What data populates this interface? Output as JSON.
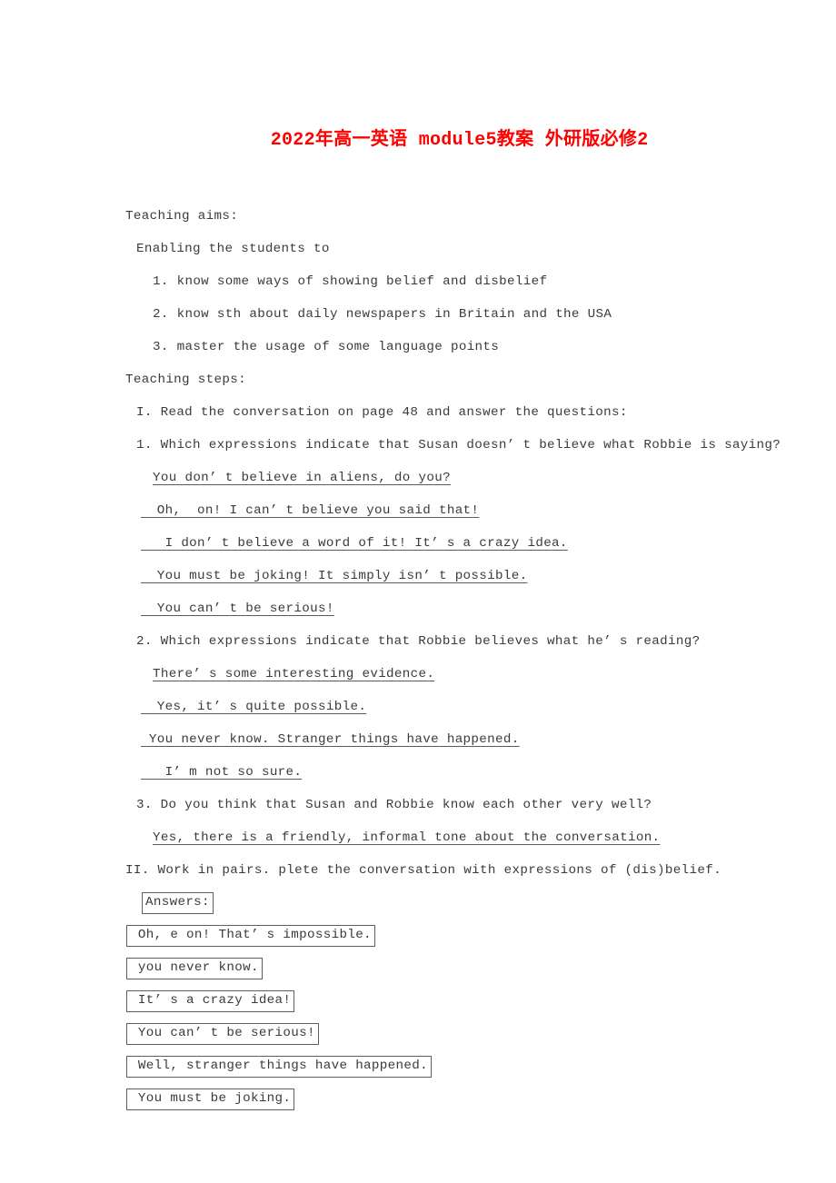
{
  "document": {
    "title": "2022年高一英语 module5教案 外研版必修2",
    "title_color": "#fe0000",
    "text_color": "#3b3b3b",
    "sections": {
      "teaching_aims_heading": "Teaching aims:",
      "enabling_line": "Enabling the students to",
      "aims": [
        "1. know some ways of showing belief and disbelief",
        "2. know sth about daily newspapers in Britain and the USA",
        "3. master the usage of some language points"
      ],
      "teaching_steps_heading": "Teaching steps:",
      "step_one_heading": "I. Read the conversation on page 48 and answer the questions:",
      "q1": "1. Which expressions indicate that Susan doesn’ t believe what Robbie is saying?",
      "q1_answers": [
        "You don’ t believe in aliens, do you?",
        "  Oh,  on! I can’ t believe you said that!",
        "   I don’ t believe a word of it! It’ s a crazy idea.",
        "  You must be joking! It simply isn’ t possible.",
        "  You can’ t be serious!"
      ],
      "q2": "2. Which expressions indicate that Robbie believes what he’ s reading?",
      "q2_answers": [
        "There’ s some interesting evidence.",
        "  Yes, it’ s quite possible.",
        " You never know. Stranger things have happened.",
        "   I’ m not so sure."
      ],
      "q3": "3. Do you think that Susan and Robbie know each other very well?",
      "q3_answers": [
        "Yes, there is a friendly, informal tone about the conversation."
      ],
      "step_two_heading": "II. Work in pairs. plete the conversation with expressions of (dis)belief.",
      "answers_label": "Answers:",
      "boxed_answers": [
        " Oh, e on! That’ s impossible.",
        " you never know.",
        " It’ s a crazy idea!",
        " You can’ t be serious!",
        " Well, stranger things have happened.",
        " You must be joking."
      ]
    }
  }
}
